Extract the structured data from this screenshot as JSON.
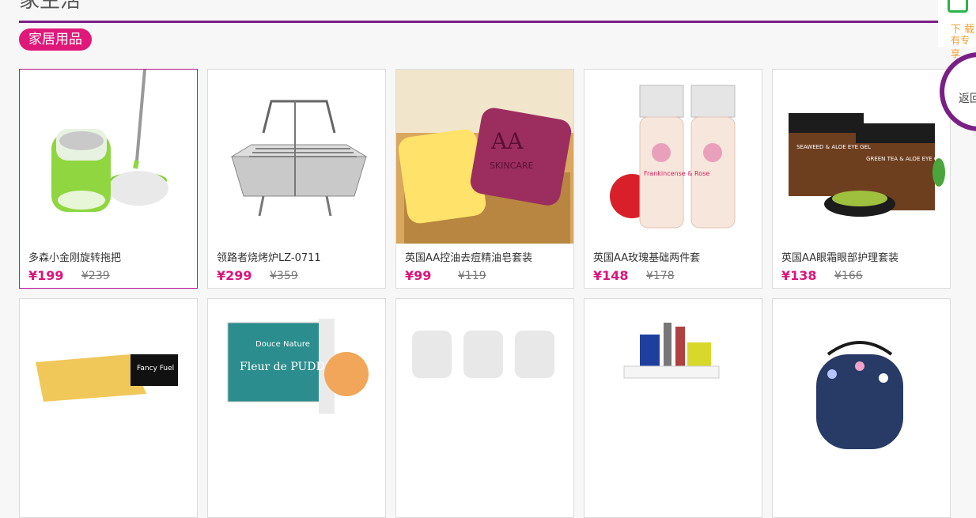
{
  "section": {
    "title": "家生活",
    "category": "家居用品"
  },
  "sidebar": {
    "download_line1": "下 载",
    "download_line2": "有专享",
    "back_label": "返回"
  },
  "products": [
    {
      "name": "多森小金刚旋转拖把",
      "price": "¥199",
      "old_price": "¥239"
    },
    {
      "name": "领路者烧烤炉LZ-0711",
      "price": "¥299",
      "old_price": "¥359"
    },
    {
      "name": "英国AA控油去痘精油皂套装",
      "price": "¥99",
      "old_price": "¥119"
    },
    {
      "name": "英国AA玫瑰基础两件套",
      "price": "¥148",
      "old_price": "¥178"
    },
    {
      "name": "英国AA眼霜眼部护理套装",
      "price": "¥138",
      "old_price": "¥166"
    }
  ],
  "product_images": {
    "soap_logo": "AA",
    "soap_label": "SKINCARE",
    "lotion_label": "Frankincense & Rose",
    "jar1_label": "SEAWEED & ALOE EYE GEL",
    "jar2_label": "GREEN TEA & ALOE EYE GEL",
    "box_brand": "Fancy Fuel",
    "cheese_brand": "Douce Nature",
    "cheese_label": "Fleur de PUDDING"
  },
  "colors": {
    "accent": "#e0187a",
    "rule": "#7a1f86",
    "price": "#d9167b"
  }
}
